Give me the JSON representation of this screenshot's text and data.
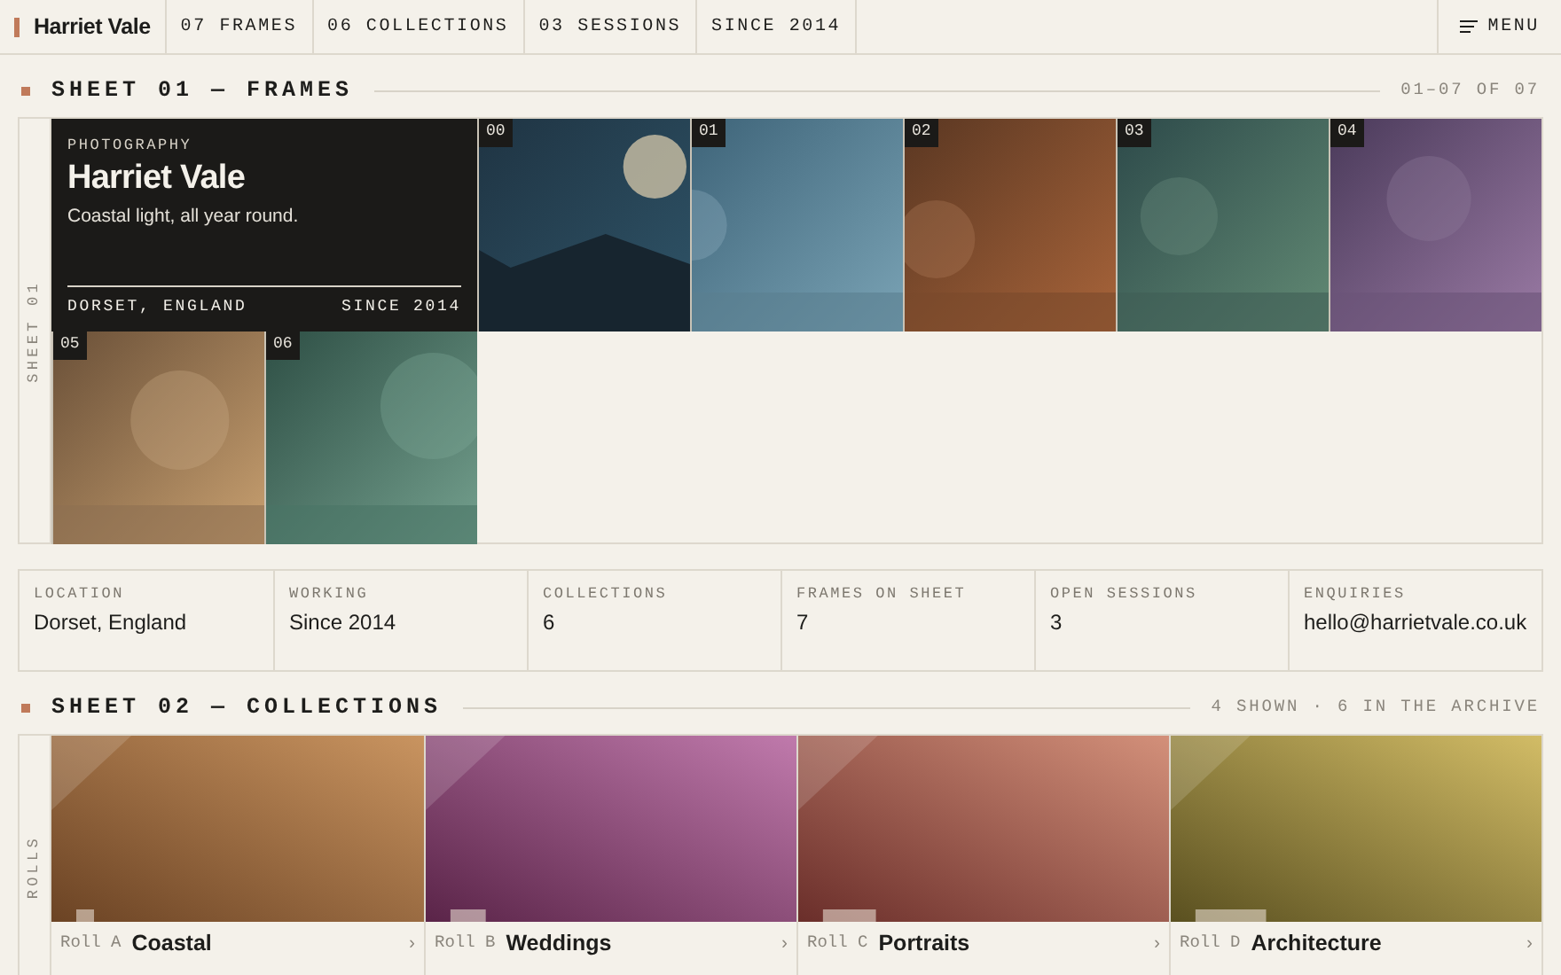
{
  "nav": {
    "brand": "Harriet Vale",
    "items": [
      "07 FRAMES",
      "06 COLLECTIONS",
      "03 SESSIONS",
      "SINCE 2014"
    ],
    "menu": "MENU"
  },
  "sheet1": {
    "title": "SHEET 01 — FRAMES",
    "count": "01–07 OF 07",
    "side_label": "SHEET 01",
    "hero": {
      "eyebrow": "PHOTOGRAPHY",
      "name": "Harriet Vale",
      "tagline": "Coastal light, all year round.",
      "location": "DORSET, ENGLAND",
      "since": "SINCE 2014"
    },
    "frames": [
      {
        "label": "00"
      },
      {
        "label": "01"
      },
      {
        "label": "02"
      },
      {
        "label": "03"
      },
      {
        "label": "04"
      },
      {
        "label": "05"
      },
      {
        "label": "06"
      }
    ]
  },
  "facts": [
    {
      "label": "LOCATION",
      "value": "Dorset, England"
    },
    {
      "label": "WORKING",
      "value": "Since 2014"
    },
    {
      "label": "COLLECTIONS",
      "value": "6"
    },
    {
      "label": "FRAMES ON SHEET",
      "value": "7"
    },
    {
      "label": "OPEN SESSIONS",
      "value": "3"
    },
    {
      "label": "ENQUIRIES",
      "value": "hello@harrietvale.co.uk"
    }
  ],
  "sheet2": {
    "title": "SHEET 02 — COLLECTIONS",
    "count": "4 SHOWN · 6 IN THE ARCHIVE",
    "side_label": "ROLLS",
    "collections": [
      {
        "roll": "Roll A",
        "name": "Coastal",
        "arrow": "›"
      },
      {
        "roll": "Roll B",
        "name": "Weddings",
        "arrow": "›"
      },
      {
        "roll": "Roll C",
        "name": "Portraits",
        "arrow": "›"
      },
      {
        "roll": "Roll D",
        "name": "Architecture",
        "arrow": "›"
      }
    ]
  }
}
